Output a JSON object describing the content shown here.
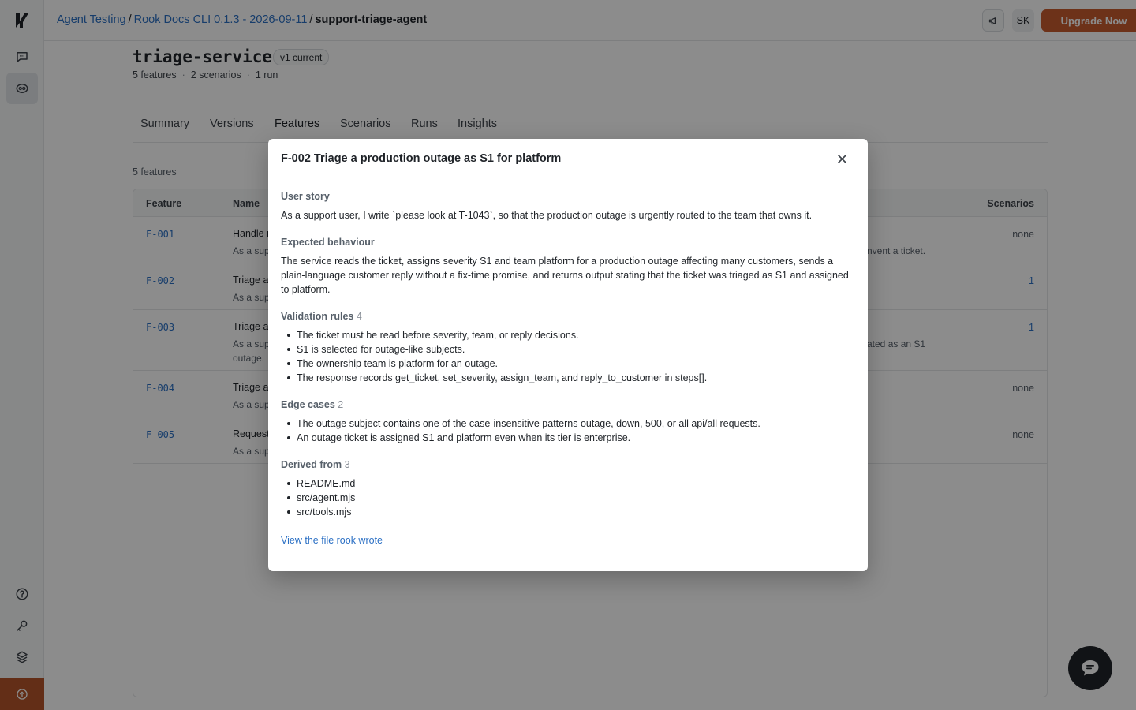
{
  "breadcrumb": {
    "items": [
      "Agent Testing",
      "Rook Docs CLI 0.1.3 - 2026-09-11"
    ],
    "separator": "/",
    "current": "support-triage-agent"
  },
  "topbar": {
    "avatar_initials": "SK",
    "upgrade_label": "Upgrade Now"
  },
  "page": {
    "title": "triage-service",
    "version_badge": "v1 current",
    "meta": [
      "5 features",
      "2 scenarios",
      "1 run"
    ],
    "meta_separator": "·",
    "features_count": "5 features"
  },
  "tabs": [
    "Summary",
    "Versions",
    "Features",
    "Scenarios",
    "Runs",
    "Insights"
  ],
  "active_tab": "Features",
  "table": {
    "headers": {
      "feature": "Feature",
      "name": "Name",
      "scenarios": "Scenarios"
    },
    "rows": [
      {
        "id": "F-001",
        "name": "Handle r",
        "desc": "As a sup",
        "desc_right": "nvent a ticket.",
        "scenarios": "none"
      },
      {
        "id": "F-002",
        "name": "Triage a",
        "desc": "As a sup",
        "desc_right": "",
        "scenarios": "1"
      },
      {
        "id": "F-003",
        "name": "Triage a",
        "desc": "As a sup",
        "desc_right": "ated as an S1",
        "desc_line2": "outage.",
        "scenarios": "1"
      },
      {
        "id": "F-004",
        "name": "Triage a",
        "desc": "As a sup",
        "desc_right": "",
        "scenarios": "none"
      },
      {
        "id": "F-005",
        "name": "Request",
        "desc": "As a sup",
        "desc_right": "",
        "scenarios": "none"
      }
    ]
  },
  "modal": {
    "title": "F-002 Triage a production outage as S1 for platform",
    "user_story_label": "User story",
    "user_story": "As a support user, I write `please look at T-1043`, so that the production outage is urgently routed to the team that owns it.",
    "expected_label": "Expected behaviour",
    "expected": "The service reads the ticket, assigns severity S1 and team platform for a production outage affecting many customers, sends a plain-language customer reply without a fix-time promise, and returns output stating that the ticket was triaged as S1 and assigned to platform.",
    "validation_label": "Validation rules",
    "validation_count": "4",
    "validation_rules": [
      "The ticket must be read before severity, team, or reply decisions.",
      "S1 is selected for outage-like subjects.",
      "The ownership team is platform for an outage.",
      "The response records get_ticket, set_severity, assign_team, and reply_to_customer in steps[]."
    ],
    "edge_label": "Edge cases",
    "edge_count": "2",
    "edge_cases": [
      "The outage subject contains one of the case-insensitive patterns outage, down, 500, or all api/all requests.",
      "An outage ticket is assigned S1 and platform even when its tier is enterprise."
    ],
    "derived_label": "Derived from",
    "derived_count": "3",
    "derived_from": [
      "README.md",
      "src/agent.mjs",
      "src/tools.mjs"
    ],
    "file_link": "View the file rook wrote"
  },
  "icons": {
    "logo": "logo-icon",
    "chat": "chat-bubble-icon",
    "agent": "agent-icon",
    "help": "help-icon",
    "key": "key-icon",
    "layers": "layers-icon",
    "upload": "upload-icon",
    "announce": "megaphone-icon",
    "close": "close-icon",
    "support_chat": "support-chat-icon"
  },
  "colors": {
    "accent": "#2a6fc4",
    "upgrade": "#c75b2e",
    "rail_bottom": "#b5542a"
  }
}
